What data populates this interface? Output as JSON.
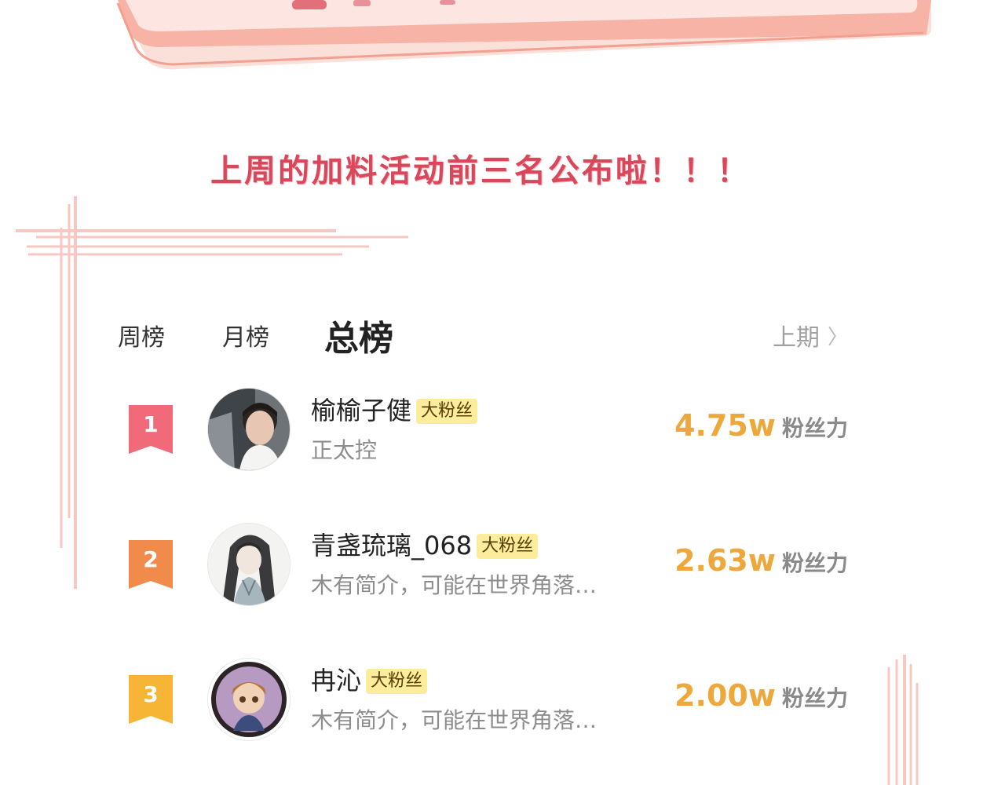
{
  "headline": "上周的加料活动前三名公布啦！！！",
  "tabs": {
    "week": "周榜",
    "month": "月榜",
    "total": "总榜"
  },
  "previous_label": "上期",
  "score_unit": "粉丝力",
  "fan_tag": "大粉丝",
  "colors": {
    "headline": "#d8475a",
    "banner_pink": "#f5a090",
    "rank1": "#f06a79",
    "rank2": "#f18b4c",
    "rank3": "#f6b534",
    "score": "#eda73a",
    "fan_tag_bg": "#fbed9c"
  },
  "ranking": [
    {
      "rank": "1",
      "name": "榆榆子健",
      "tag": "大粉丝",
      "desc": "正太控",
      "score": "4.75w",
      "unit": "粉丝力"
    },
    {
      "rank": "2",
      "name": "青盏琉璃_068",
      "tag": "大粉丝",
      "desc": "木有简介，可能在世界角落…",
      "score": "2.63w",
      "unit": "粉丝力"
    },
    {
      "rank": "3",
      "name": "冉沁",
      "tag": "大粉丝",
      "desc": "木有简介，可能在世界角落…",
      "score": "2.00w",
      "unit": "粉丝力"
    }
  ]
}
